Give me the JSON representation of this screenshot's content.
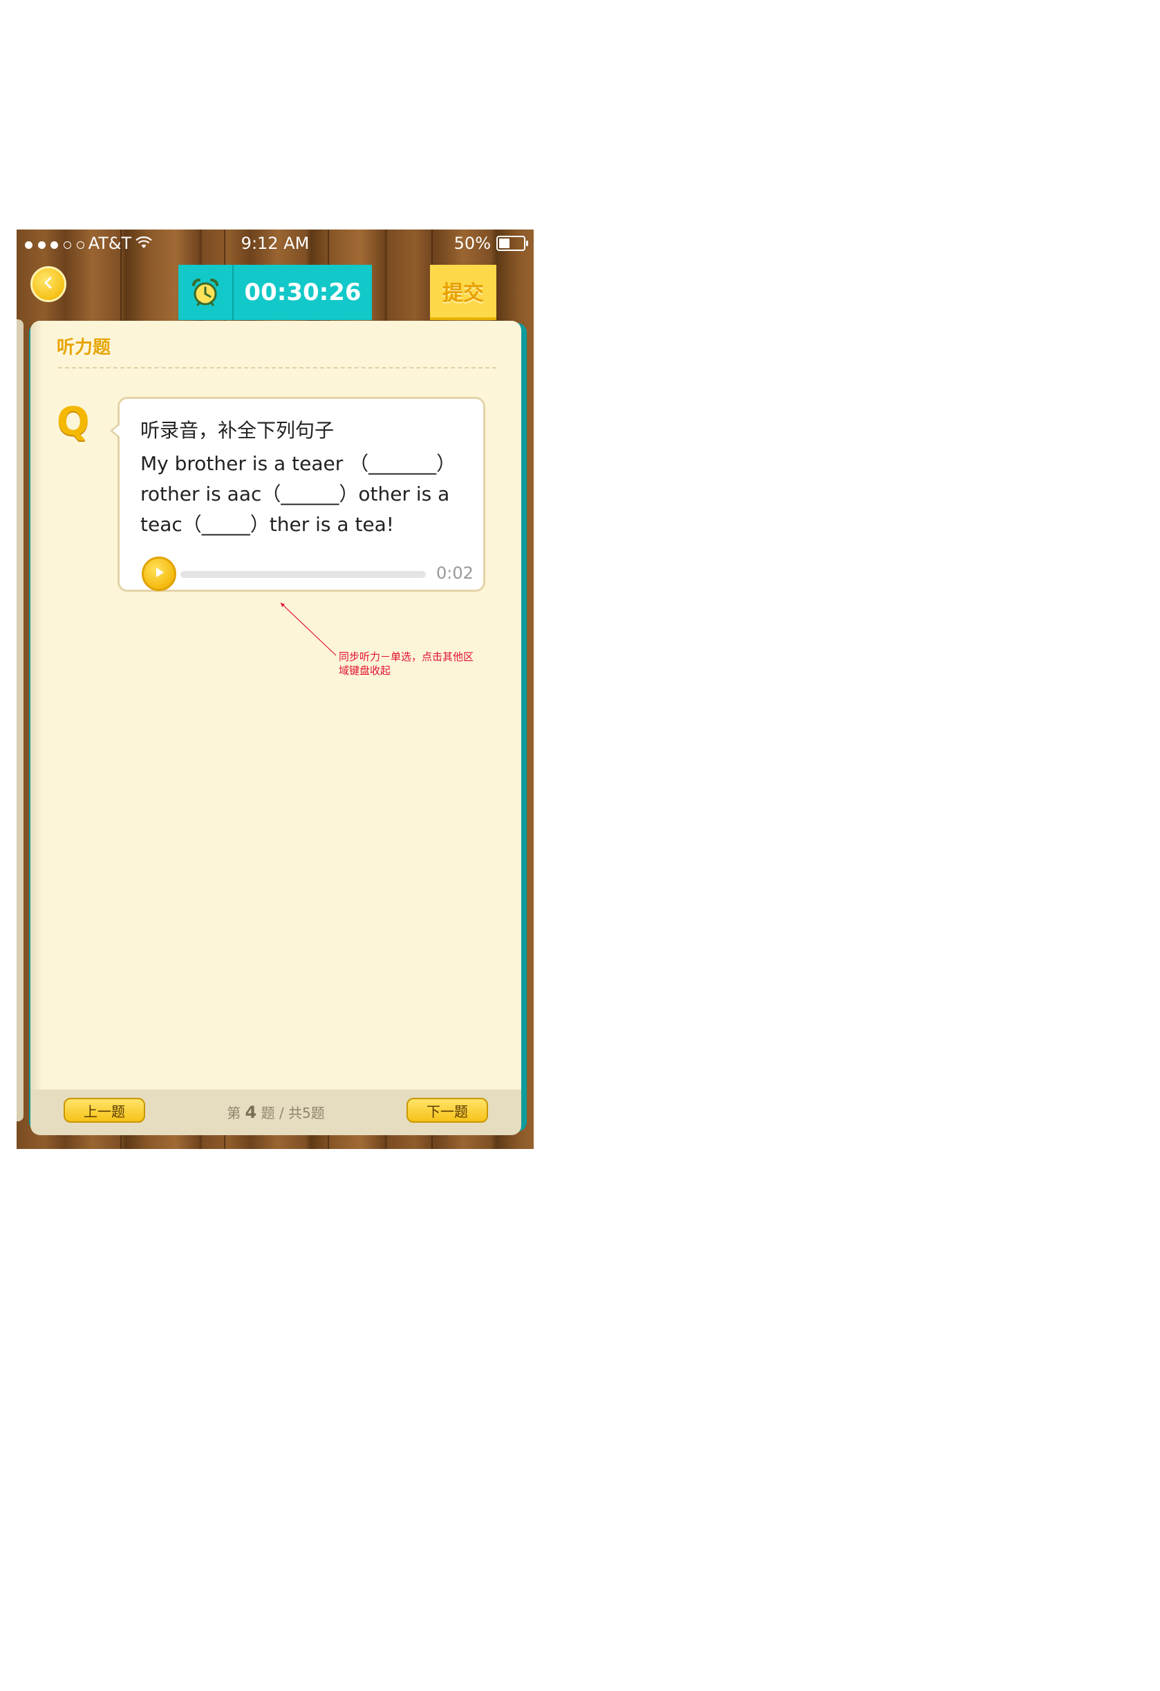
{
  "status_bar": {
    "carrier": "AT&T",
    "time": "9:12 AM",
    "battery": "50%",
    "battery_level": 0.5
  },
  "header": {
    "back_icon": "chevron-left-icon",
    "timer_icon": "alarm-clock-icon",
    "timer": "00:30:26",
    "submit_label": "提交"
  },
  "card": {
    "section_title": "听力题",
    "question": {
      "marker": "Q",
      "instruction": "听录音，补全下列句子",
      "lines": [
        "My brother is a teaer （_______）",
        "rother is aac（______）other is a",
        "teac（_____）ther is a tea!"
      ]
    },
    "audio": {
      "play_icon": "play-icon",
      "progress": 0,
      "time": "0:02"
    }
  },
  "annotation": {
    "text_line1": "同步听力－单选，点击其他区",
    "text_line2": "域键盘收起",
    "color": "#e0102e"
  },
  "footer": {
    "prev_label": "上一题",
    "next_label": "下一题",
    "page_prefix": "第",
    "current": "4",
    "page_middle": "题 / 共5题"
  },
  "colors": {
    "teal": "#12c8c8",
    "yellow": "#f6c218",
    "paper": "#fdf5d8",
    "wood": "#7a4c22"
  }
}
